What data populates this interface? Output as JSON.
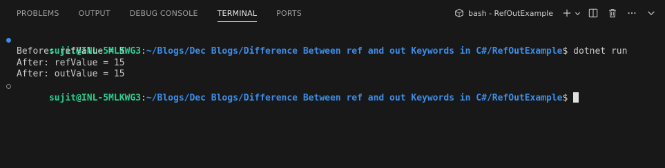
{
  "tabs": [
    {
      "label": "PROBLEMS"
    },
    {
      "label": "OUTPUT"
    },
    {
      "label": "DEBUG CONSOLE"
    },
    {
      "label": "TERMINAL",
      "active": true
    },
    {
      "label": "PORTS"
    }
  ],
  "actions": {
    "terminal_name": "bash - RefOutExample"
  },
  "terminal": {
    "user_host": "sujit@INL-5MLKWG3",
    "colon": ":",
    "path": "~/Blogs/Dec Blogs/Difference Between ref and out Keywords in C#/RefOutExample",
    "prompt_char": "$",
    "command": " dotnet run",
    "output": [
      "Before: refValue = 5",
      "After: refValue = 15",
      "After: outValue = 15"
    ]
  },
  "colors": {
    "background": "#181818",
    "user": "#23d18b",
    "path": "#3b8eea",
    "text": "#cccccc"
  }
}
